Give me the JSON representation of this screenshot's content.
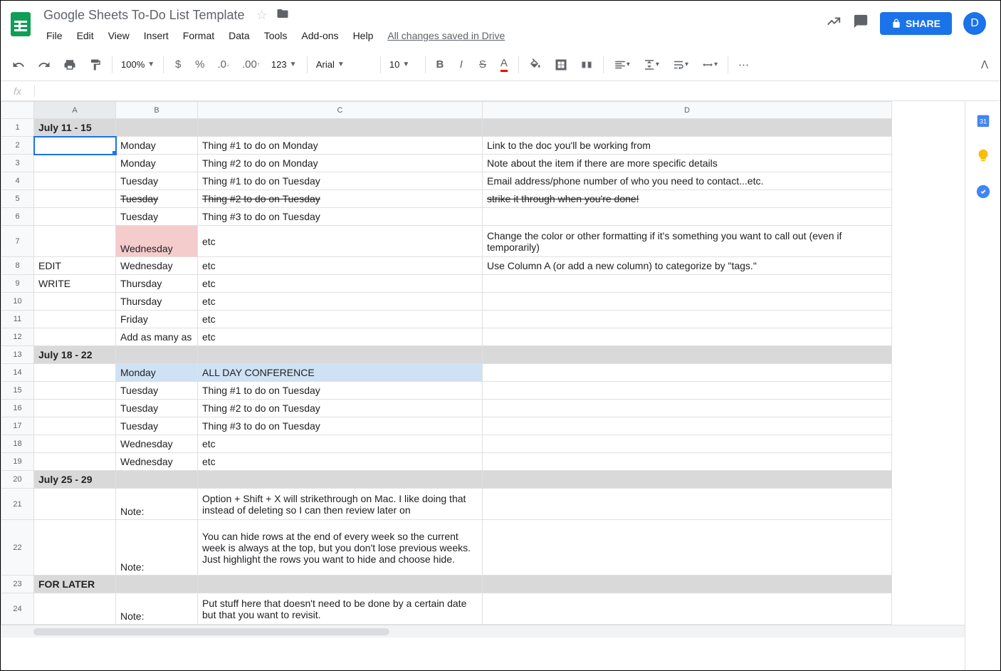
{
  "doc_title": "Google Sheets To-Do List Template",
  "menu": [
    "File",
    "Edit",
    "View",
    "Insert",
    "Format",
    "Data",
    "Tools",
    "Add-ons",
    "Help"
  ],
  "saved": "All changes saved in Drive",
  "share": "SHARE",
  "avatar": "D",
  "toolbar": {
    "zoom": "100%",
    "font": "Arial",
    "font_size": "10",
    "numfmt": "123"
  },
  "fx": "fx",
  "columns": [
    "A",
    "B",
    "C",
    "D"
  ],
  "rows": [
    {
      "n": "1",
      "a": "July 11 - 15",
      "b": "",
      "c": "",
      "d": "",
      "gray": true,
      "bold": true
    },
    {
      "n": "2",
      "a": "",
      "b": "Monday",
      "c": "Thing #1 to do on Monday",
      "d": "Link to the doc you'll be working from",
      "sel": true
    },
    {
      "n": "3",
      "a": "",
      "b": "Monday",
      "c": "Thing #2 to do on Monday",
      "d": "Note about the item if there are more specific details"
    },
    {
      "n": "4",
      "a": "",
      "b": "Tuesday",
      "c": "Thing #1 to do on Tuesday",
      "d": "Email address/phone number of who you need to contact...etc."
    },
    {
      "n": "5",
      "a": "",
      "b": "Tuesday",
      "c": "Thing #2 to do on Tuesday",
      "d": "strike it through when you're done!",
      "strike": true
    },
    {
      "n": "6",
      "a": "",
      "b": "Tuesday",
      "c": "Thing #3 to do on Tuesday",
      "d": ""
    },
    {
      "n": "7",
      "a": "",
      "b": "Wednesday",
      "c": "etc",
      "d": "Change the color or other formatting if it's something you want to call out (even if temporarily)",
      "red_b": true,
      "tall": true
    },
    {
      "n": "8",
      "a": "EDIT",
      "b": "Wednesday",
      "c": "etc",
      "d": "Use Column A (or add a new column) to categorize by \"tags.\""
    },
    {
      "n": "9",
      "a": "WRITE",
      "b": "Thursday",
      "c": "etc",
      "d": ""
    },
    {
      "n": "10",
      "a": "",
      "b": "Thursday",
      "c": "etc",
      "d": ""
    },
    {
      "n": "11",
      "a": "",
      "b": "Friday",
      "c": "etc",
      "d": ""
    },
    {
      "n": "12",
      "a": "",
      "b": "Add as many as",
      "c": "etc",
      "d": ""
    },
    {
      "n": "13",
      "a": "July 18 - 22",
      "b": "",
      "c": "",
      "d": "",
      "gray": true,
      "bold": true
    },
    {
      "n": "14",
      "a": "",
      "b": "Monday",
      "c": "ALL DAY CONFERENCE",
      "d": "",
      "blue_bc": true
    },
    {
      "n": "15",
      "a": "",
      "b": "Tuesday",
      "c": "Thing #1 to do on Tuesday",
      "d": ""
    },
    {
      "n": "16",
      "a": "",
      "b": "Tuesday",
      "c": "Thing #2 to do on Tuesday",
      "d": ""
    },
    {
      "n": "17",
      "a": "",
      "b": "Tuesday",
      "c": "Thing #3 to do on Tuesday",
      "d": ""
    },
    {
      "n": "18",
      "a": "",
      "b": "Wednesday",
      "c": "etc",
      "d": ""
    },
    {
      "n": "19",
      "a": "",
      "b": "Wednesday",
      "c": "etc",
      "d": ""
    },
    {
      "n": "20",
      "a": "July 25 - 29",
      "b": "",
      "c": "",
      "d": "",
      "gray": true,
      "bold": true
    },
    {
      "n": "21",
      "a": "",
      "b": "Note:",
      "c": "Option + Shift + X will strikethrough on Mac. I like doing that instead of deleting so I can then review later on",
      "d": "",
      "tall": true
    },
    {
      "n": "22",
      "a": "",
      "b": "Note:",
      "c": "You can hide rows at the end of every week so the current week is always at the top, but you don't lose previous weeks. Just highlight the rows you want to hide and choose hide.",
      "d": "",
      "tall2": true
    },
    {
      "n": "23",
      "a": "FOR LATER",
      "b": "",
      "c": "",
      "d": "",
      "gray": true,
      "bold": true
    },
    {
      "n": "24",
      "a": "",
      "b": "Note:",
      "c": "Put stuff here that doesn't need to be done by a certain date but that you want to revisit.",
      "d": "",
      "tall": true
    }
  ]
}
